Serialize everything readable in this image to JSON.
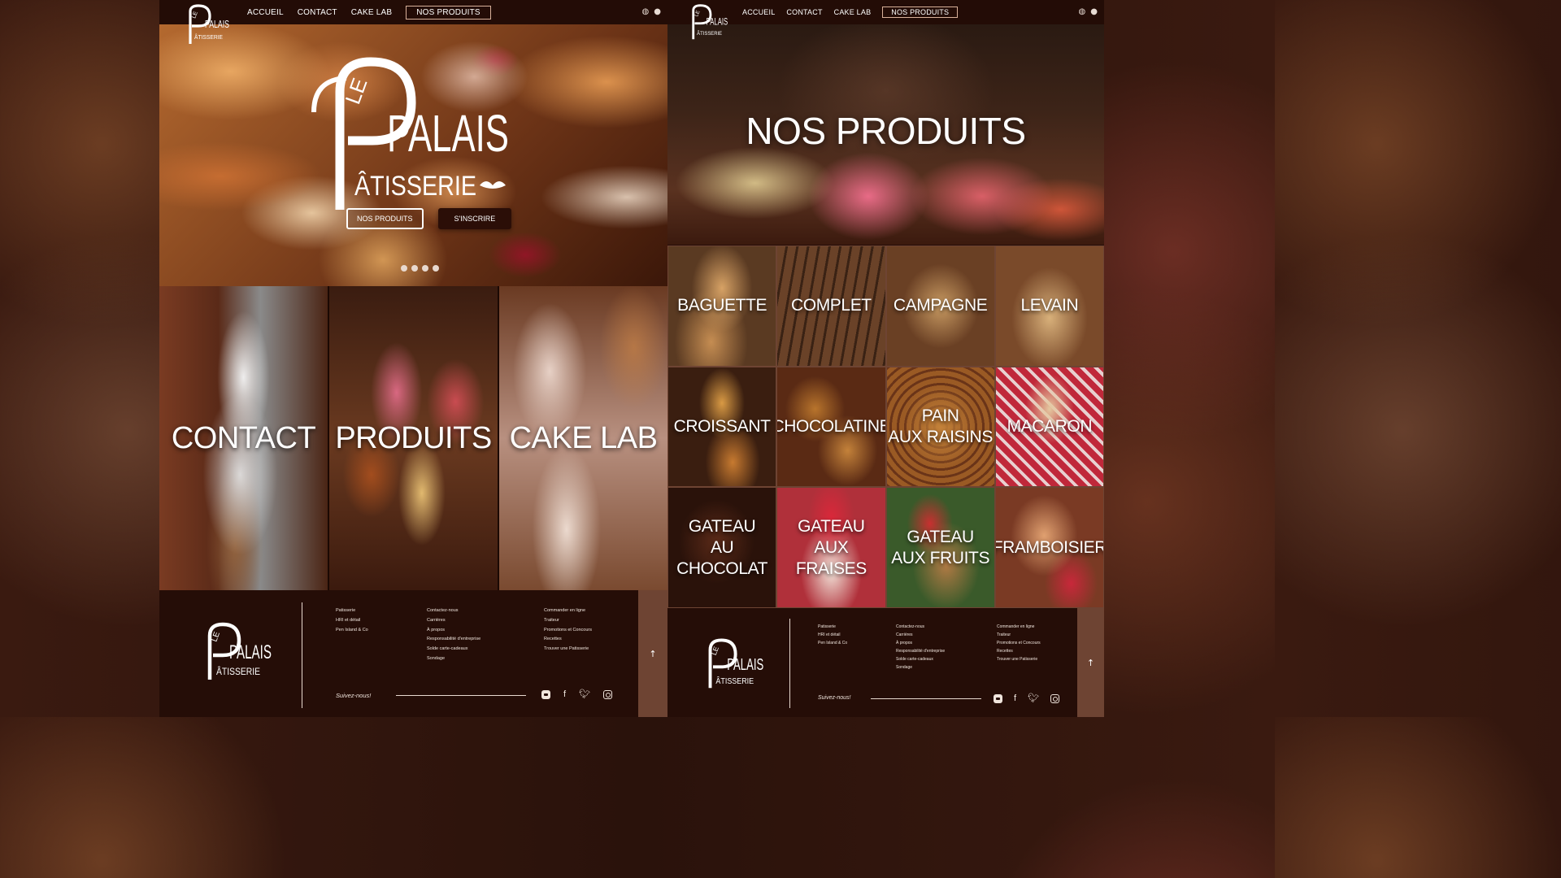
{
  "brand": {
    "logo_text_le": "LE",
    "logo_text_palais": "PALAIS",
    "logo_text_patisserie": "ÂTISSERIE"
  },
  "nav": {
    "links": [
      "ACCUEIL",
      "CONTACT",
      "CAKE LAB",
      "NOS PRODUITS"
    ],
    "active": "NOS PRODUITS",
    "icons": [
      "globe-icon",
      "user-icon"
    ]
  },
  "home": {
    "hero": {
      "button_products": "NOS PRODUITS",
      "button_signup": "S'INSCRIRE",
      "slides_count": 4
    },
    "tiles": [
      "CONTACT",
      "PRODUITS",
      "CAKE LAB"
    ]
  },
  "products_page": {
    "hero_title": "NOS PRODUITS",
    "products": [
      "BAGUETTE",
      "COMPLET",
      "CAMPAGNE",
      "LEVAIN",
      "CROISSANT",
      "CHOCOLATINE",
      "PAIN\nAUX RAISINS",
      "MACARON",
      "GATEAU\nAU CHOCOLAT",
      "GATEAU\nAUX FRAISES",
      "GATEAU\nAUX FRUITS",
      "FRAMBOISIER"
    ]
  },
  "footer": {
    "col1": [
      "Patisserie",
      "HRI et détail",
      "Pen Island & Co"
    ],
    "col2": [
      "Contactez-nous",
      "Carrières",
      "À propos",
      "Responsabilité d'entreprise",
      "Solde carte-cadeaux",
      "Sondage"
    ],
    "col3": [
      "Commander en ligne",
      "Traiteur",
      "Promotions et Concours",
      "Recettes",
      "Trouver une Patisserie"
    ],
    "follow": "Suivez-nous!",
    "social_icons": [
      "blogger-icon",
      "facebook-icon",
      "twitter-icon",
      "instagram-icon"
    ],
    "back_to_top_icon": "arrow-up-icon"
  },
  "colors": {
    "brand_dark": "#250d07",
    "accent_tan": "#d9b19a",
    "back_to_top": "#6e4433"
  }
}
